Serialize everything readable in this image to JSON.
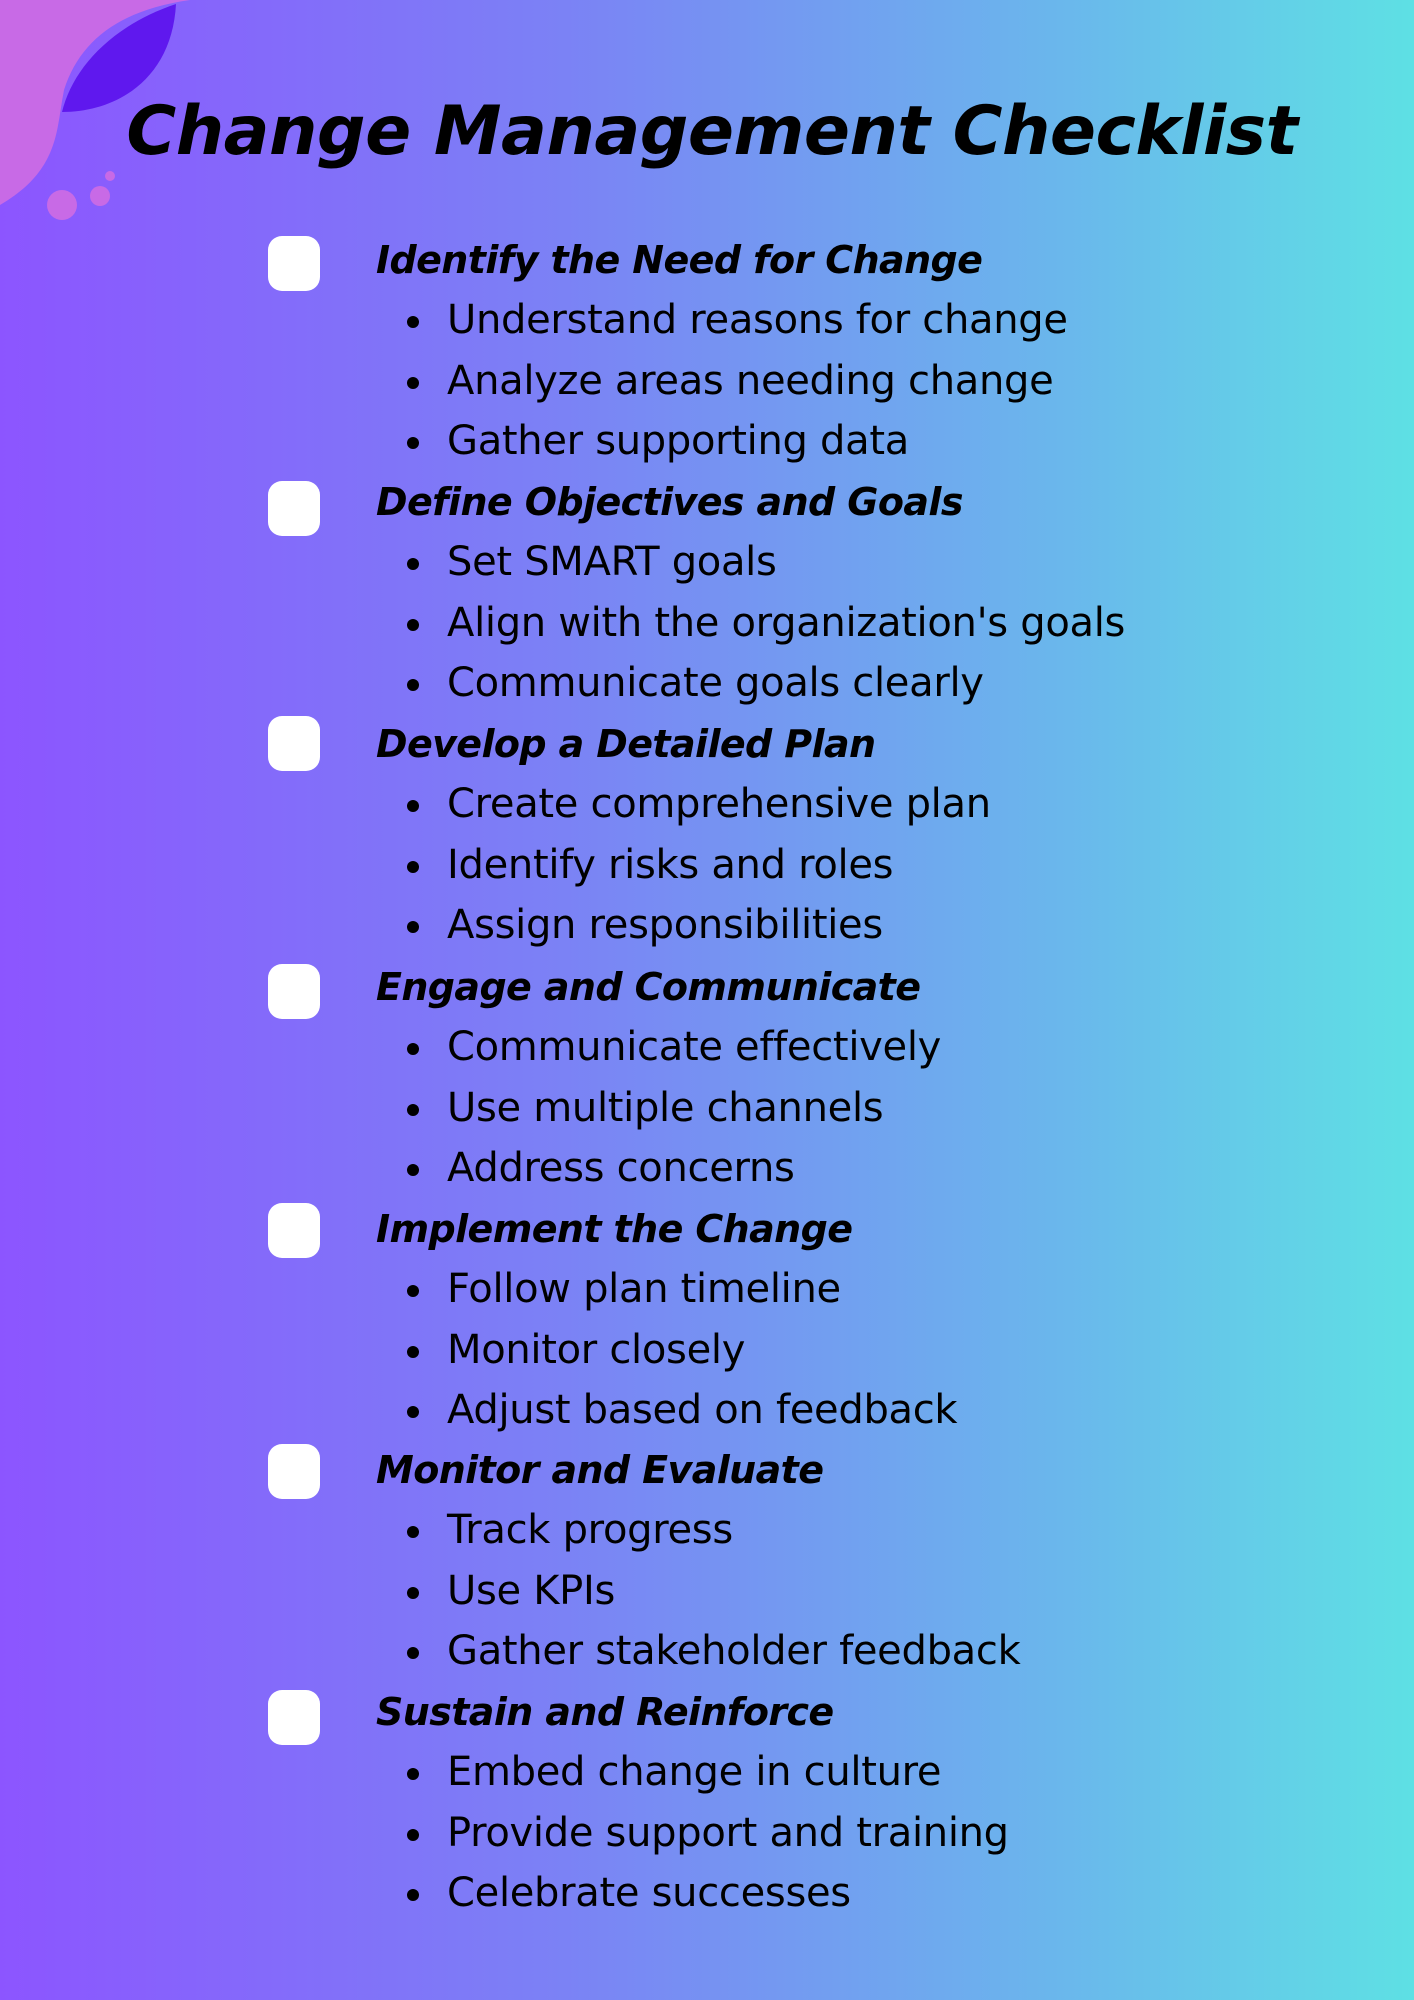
{
  "title": "Change Management Checklist",
  "colors": {
    "gradient_left": "#8c55ff",
    "gradient_right": "#5ee0e4",
    "blob_pink": "#c86ae6",
    "blob_violet": "#5f18ee",
    "checkbox": "#ffffff",
    "text": "#000000"
  },
  "sections": [
    {
      "heading": "Identify the Need for Change",
      "checked": false,
      "items": [
        "Understand reasons for change",
        "Analyze areas needing change",
        "Gather supporting data"
      ]
    },
    {
      "heading": "Define Objectives and Goals",
      "checked": false,
      "items": [
        "Set SMART goals",
        "Align with the organization's goals",
        "Communicate goals clearly"
      ]
    },
    {
      "heading": "Develop a Detailed Plan",
      "checked": false,
      "items": [
        "Create comprehensive plan",
        "Identify risks and roles",
        "Assign responsibilities"
      ]
    },
    {
      "heading": "Engage and Communicate",
      "checked": false,
      "items": [
        "Communicate effectively",
        "Use multiple channels",
        "Address concerns"
      ]
    },
    {
      "heading": "Implement the Change",
      "checked": false,
      "items": [
        "Follow plan timeline",
        "Monitor closely",
        "Adjust based on feedback"
      ]
    },
    {
      "heading": "Monitor and Evaluate",
      "checked": false,
      "items": [
        "Track progress",
        "Use KPIs",
        "Gather stakeholder feedback"
      ]
    },
    {
      "heading": "Sustain and Reinforce",
      "checked": false,
      "items": [
        "Embed change in culture",
        "Provide support and training",
        "Celebrate successes"
      ]
    }
  ]
}
